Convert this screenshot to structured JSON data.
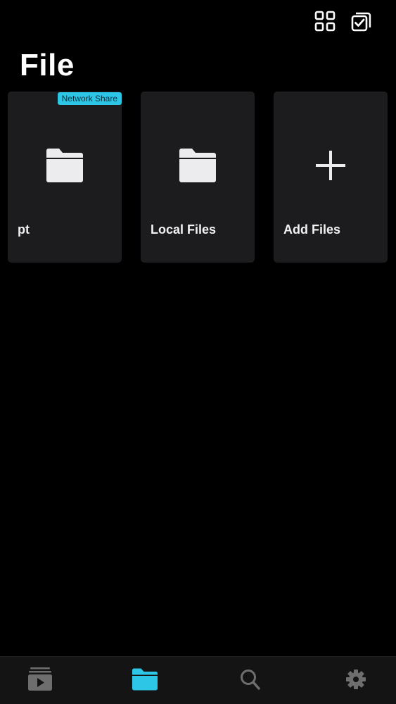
{
  "header": {
    "title": "File",
    "grid_view_icon": "grid-icon",
    "select_icon": "checkbox-select-icon"
  },
  "tiles": [
    {
      "label": "pt",
      "badge": "Network Share",
      "icon": "folder-icon"
    },
    {
      "label": "Local Files",
      "badge": "",
      "icon": "folder-icon"
    },
    {
      "label": "Add Files",
      "badge": "",
      "icon": "plus-icon"
    }
  ],
  "tab_bar": {
    "items": [
      {
        "name": "media",
        "icon": "media-library-icon",
        "active": false
      },
      {
        "name": "files",
        "icon": "folder-icon",
        "active": true
      },
      {
        "name": "search",
        "icon": "search-icon",
        "active": false
      },
      {
        "name": "settings",
        "icon": "gear-icon",
        "active": false
      }
    ]
  },
  "colors": {
    "background": "#000000",
    "tile": "#1c1c1e",
    "accent": "#2dc6e6",
    "inactive_icon": "#6e6e6e",
    "text": "#f2f2f2"
  }
}
